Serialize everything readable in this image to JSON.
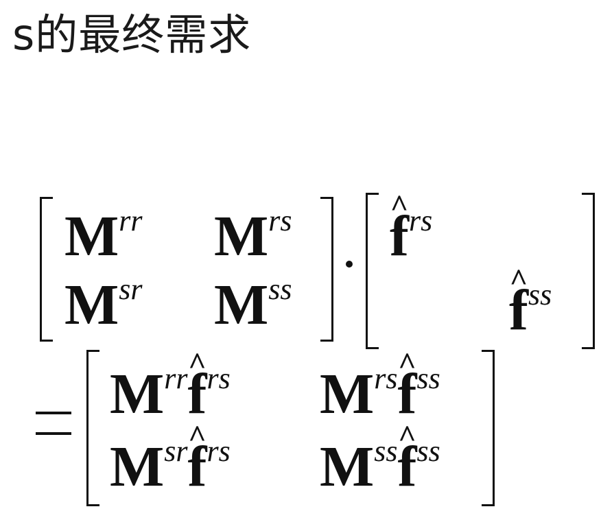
{
  "title": "s的最终需求",
  "math": {
    "M": "M",
    "f": "f",
    "hat": "^",
    "rr": "rr",
    "rs": "rs",
    "sr": "sr",
    "ss": "ss"
  }
}
